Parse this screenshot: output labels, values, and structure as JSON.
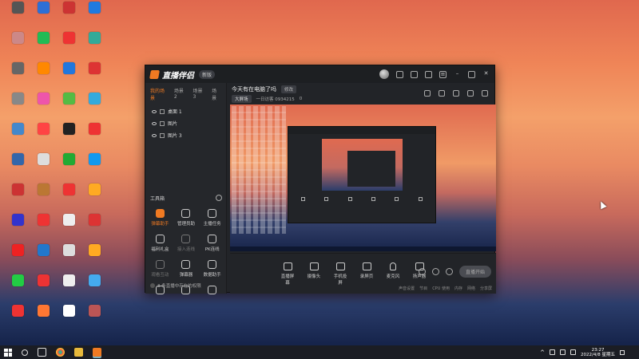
{
  "desktop": {
    "icons": [
      {
        "label": "",
        "c": "#555"
      },
      {
        "label": "",
        "c": "#2d6fd6"
      },
      {
        "label": "",
        "c": "#c33"
      },
      {
        "label": "",
        "c": "#1f7ae0"
      },
      {
        "label": "",
        "c": "#c88"
      },
      {
        "label": "",
        "c": "#2b5"
      },
      {
        "label": "",
        "c": "#e33"
      },
      {
        "label": "",
        "c": "#3a9"
      },
      {
        "label": "",
        "c": "#666"
      },
      {
        "label": "",
        "c": "#f80"
      },
      {
        "label": "",
        "c": "#27d"
      },
      {
        "label": "",
        "c": "#d33"
      },
      {
        "label": "",
        "c": "#888"
      },
      {
        "label": "",
        "c": "#e5a"
      },
      {
        "label": "",
        "c": "#5b4"
      },
      {
        "label": "",
        "c": "#3ad"
      },
      {
        "label": "",
        "c": "#48c"
      },
      {
        "label": "",
        "c": "#f44"
      },
      {
        "label": "",
        "c": "#222"
      },
      {
        "label": "",
        "c": "#e33"
      },
      {
        "label": "",
        "c": "#36a"
      },
      {
        "label": "",
        "c": "#ddd"
      },
      {
        "label": "",
        "c": "#2a3"
      },
      {
        "label": "",
        "c": "#19e"
      },
      {
        "label": "",
        "c": "#c33"
      },
      {
        "label": "",
        "c": "#b73"
      },
      {
        "label": "",
        "c": "#e33"
      },
      {
        "label": "",
        "c": "#fa2"
      },
      {
        "label": "",
        "c": "#33c"
      },
      {
        "label": "",
        "c": "#e33"
      },
      {
        "label": "",
        "c": "#eee"
      },
      {
        "label": "",
        "c": "#d33"
      },
      {
        "label": "",
        "c": "#e22"
      },
      {
        "label": "",
        "c": "#27c"
      },
      {
        "label": "",
        "c": "#ddd"
      },
      {
        "label": "",
        "c": "#fa2"
      },
      {
        "label": "",
        "c": "#2c4"
      },
      {
        "label": "",
        "c": "#e33"
      },
      {
        "label": "",
        "c": "#eee"
      },
      {
        "label": "",
        "c": "#4ae"
      },
      {
        "label": "",
        "c": "#e33"
      },
      {
        "label": "",
        "c": "#f73"
      },
      {
        "label": "",
        "c": "#fff"
      },
      {
        "label": "",
        "c": "#b55"
      }
    ]
  },
  "app": {
    "title": "直播伴侣",
    "version_badge": "新版",
    "scene_tabs": [
      "我的场景",
      "场景 2",
      "场景 3",
      "场景"
    ],
    "sources": [
      "桌面 1",
      "图片",
      "图片 3"
    ],
    "tools_header": "工具箱",
    "tools": [
      {
        "label": "弹幕助手",
        "state": "hot"
      },
      {
        "label": "管理员助",
        "state": ""
      },
      {
        "label": "主播任务",
        "state": ""
      },
      {
        "label": "福利礼盒",
        "state": ""
      },
      {
        "label": "接入连线",
        "state": "dim"
      },
      {
        "label": "PK连线",
        "state": ""
      },
      {
        "label": "观看互动",
        "state": "dim"
      },
      {
        "label": "弹幕器",
        "state": ""
      },
      {
        "label": "数据助手",
        "state": ""
      },
      {
        "label": "",
        "state": ""
      },
      {
        "label": "",
        "state": ""
      },
      {
        "label": "",
        "state": ""
      }
    ],
    "left_footer": "3 条直播中存在的权限",
    "room_title": "今天有在电脑了吗",
    "room_edit": "修改",
    "room_category": "大屏场",
    "room_info": "一日访客 0934215",
    "room_count": "0",
    "controls": [
      "直播屏幕",
      "摄像头",
      "手机投屏",
      "录屏页",
      "麦克风",
      "扬声器"
    ],
    "start_button": "直播开始",
    "status_items": [
      "声音设置",
      "节目",
      "CPU 使用",
      "内存",
      "网络",
      "分享屏"
    ]
  },
  "taskbar": {
    "time": "23:27",
    "date": "2022/4/8 星期五"
  }
}
